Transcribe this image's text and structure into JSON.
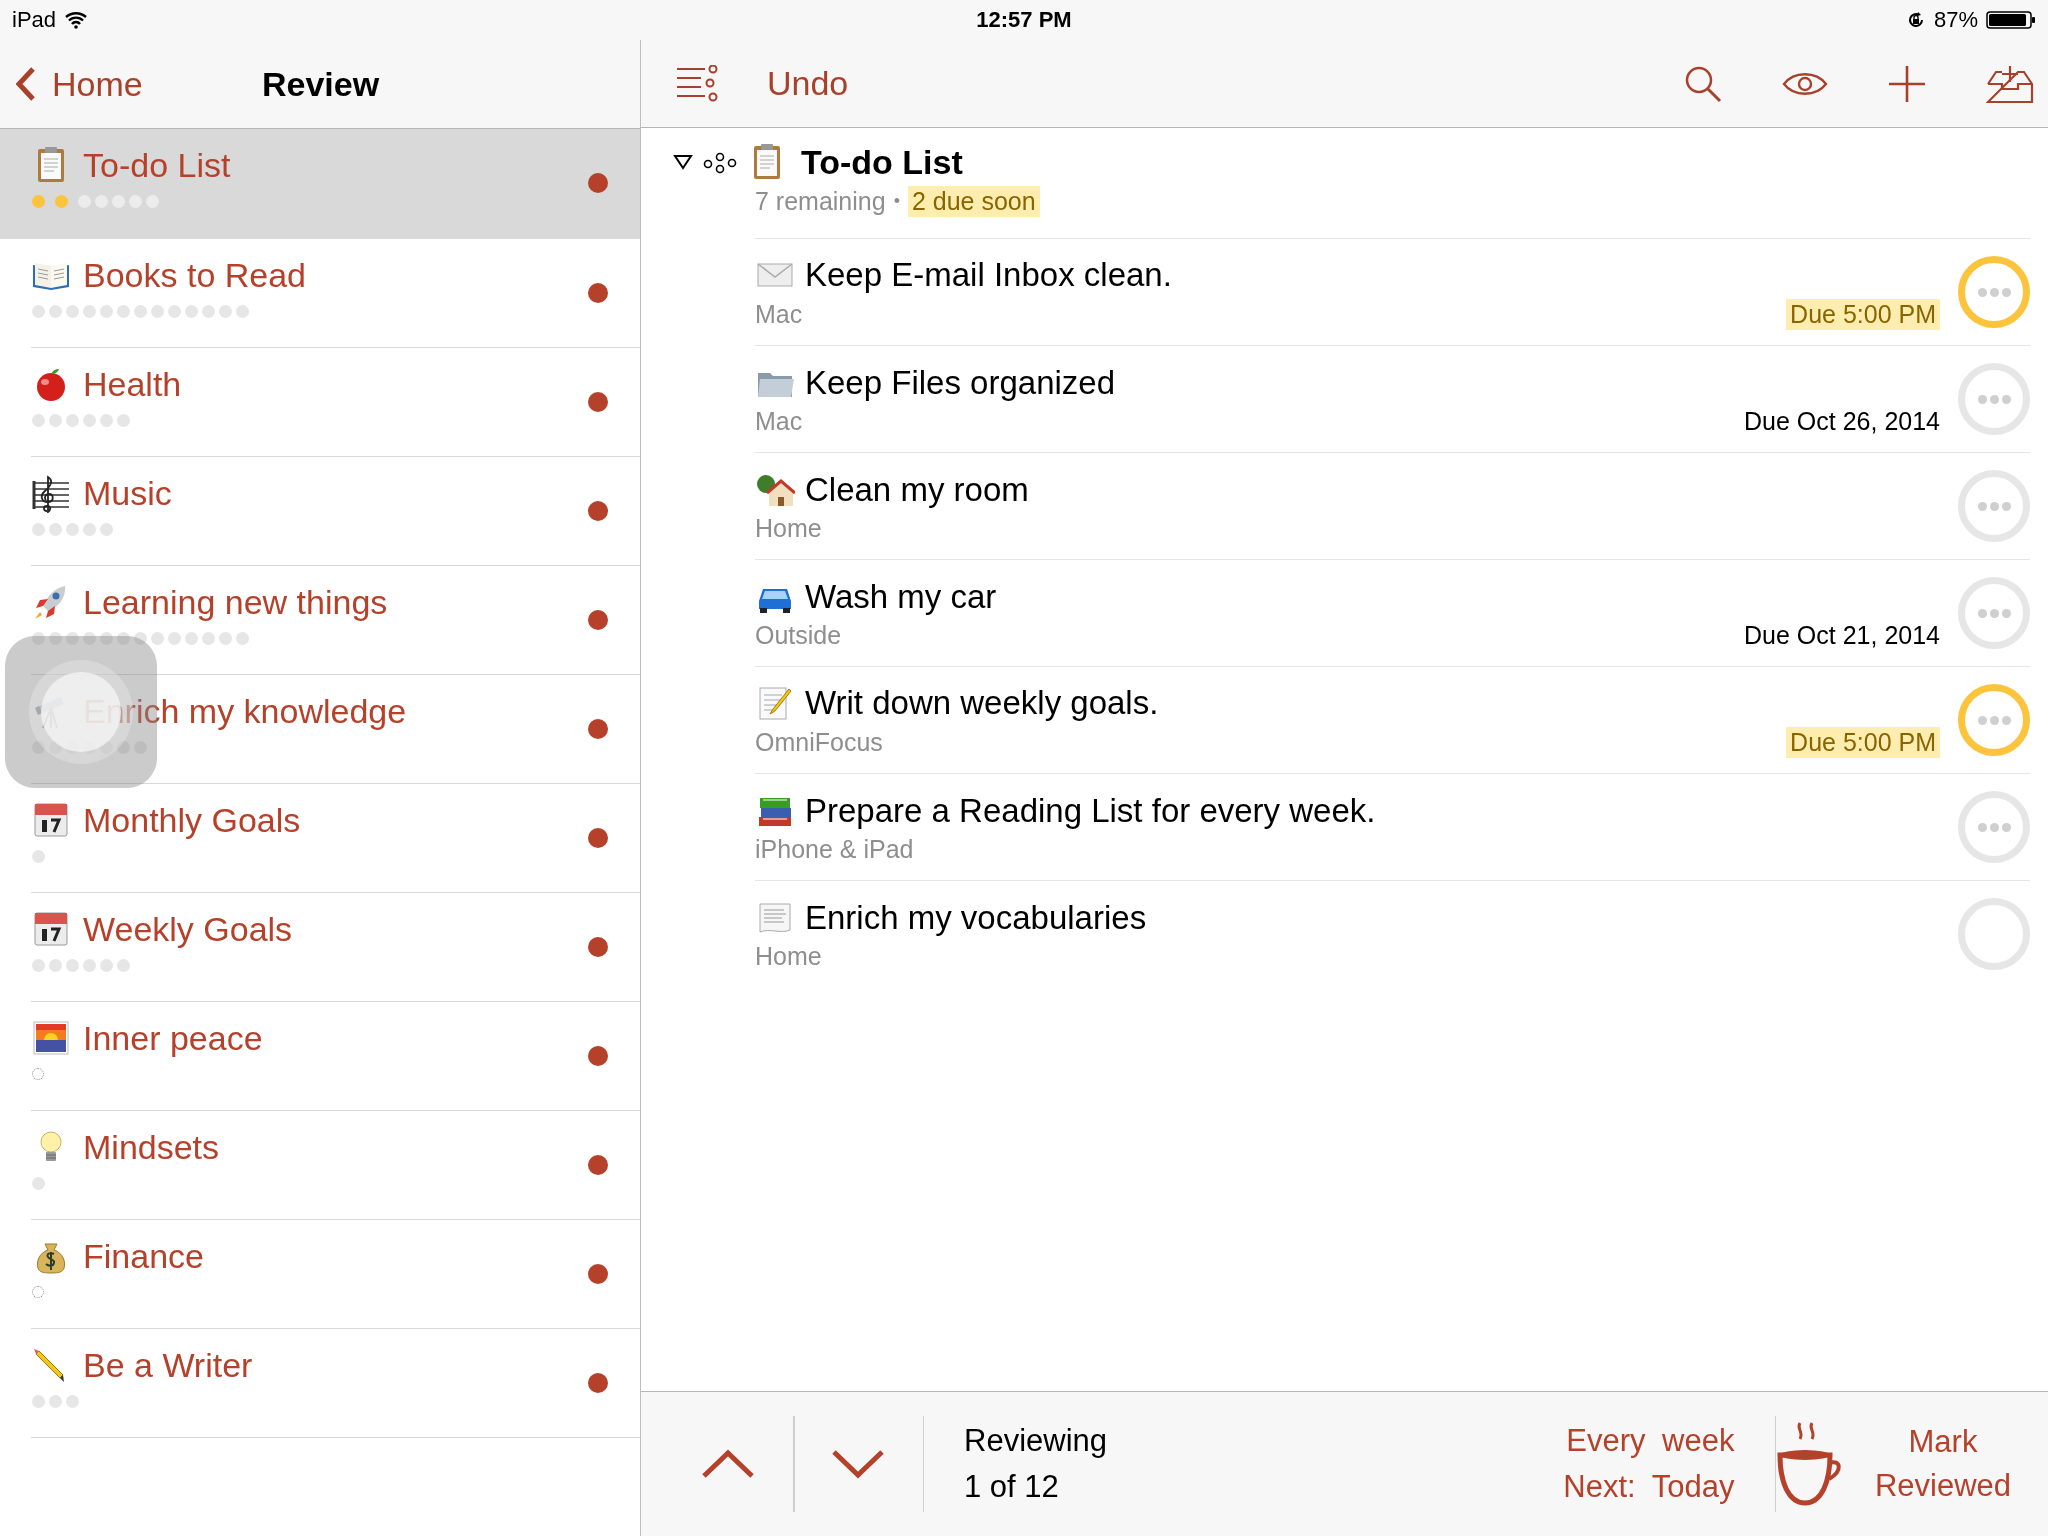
{
  "status_bar": {
    "device": "iPad",
    "time": "12:57 PM",
    "battery": "87%"
  },
  "sidebar": {
    "back": "Home",
    "title": "Review",
    "items": [
      {
        "label": "To-do List",
        "selected": true,
        "dots": [
          {
            "due_soon": true
          },
          {
            "due_soon": true
          },
          {
            "due_soon": false
          },
          {
            "due_soon": false
          },
          {
            "due_soon": false
          },
          {
            "due_soon": false
          },
          {
            "due_soon": false
          }
        ]
      },
      {
        "label": "Books to Read",
        "selected": false,
        "dots": [
          {
            "due_soon": false
          },
          {
            "due_soon": false
          },
          {
            "due_soon": false
          },
          {
            "due_soon": false
          },
          {
            "due_soon": false
          },
          {
            "due_soon": false
          },
          {
            "due_soon": false
          },
          {
            "due_soon": false
          },
          {
            "due_soon": false
          },
          {
            "due_soon": false
          },
          {
            "due_soon": false
          },
          {
            "due_soon": false
          },
          {
            "due_soon": false
          }
        ]
      },
      {
        "label": "Health",
        "selected": false,
        "dots": [
          {
            "due_soon": false
          },
          {
            "due_soon": false
          },
          {
            "due_soon": false
          },
          {
            "due_soon": false
          },
          {
            "due_soon": false
          },
          {
            "due_soon": false
          }
        ]
      },
      {
        "label": "Music",
        "selected": false,
        "dots": [
          {
            "due_soon": false
          },
          {
            "due_soon": false
          },
          {
            "due_soon": false
          },
          {
            "due_soon": false
          },
          {
            "due_soon": false
          }
        ]
      },
      {
        "label": "Learning new things",
        "selected": false,
        "dots": [
          {
            "due_soon": false
          },
          {
            "due_soon": false
          },
          {
            "due_soon": false
          },
          {
            "due_soon": false
          },
          {
            "due_soon": false
          },
          {
            "due_soon": false
          },
          {
            "due_soon": false
          },
          {
            "due_soon": false
          },
          {
            "due_soon": false
          },
          {
            "due_soon": false
          },
          {
            "due_soon": false
          },
          {
            "due_soon": false
          },
          {
            "due_soon": false
          }
        ]
      },
      {
        "label": "Enrich my knowledge",
        "selected": false,
        "dots": [
          {
            "due_soon": false
          },
          {
            "due_soon": false
          },
          {
            "due_soon": false
          },
          {
            "due_soon": false
          },
          {
            "due_soon": false
          },
          {
            "due_soon": false
          },
          {
            "due_soon": false
          }
        ]
      },
      {
        "label": "Monthly Goals",
        "selected": false,
        "dots": [
          {
            "due_soon": false
          }
        ]
      },
      {
        "label": "Weekly Goals",
        "selected": false,
        "dots": [
          {
            "due_soon": false
          },
          {
            "due_soon": false
          },
          {
            "due_soon": false
          },
          {
            "due_soon": false
          },
          {
            "due_soon": false
          },
          {
            "due_soon": false
          }
        ]
      },
      {
        "label": "Inner peace",
        "selected": false
      },
      {
        "label": "Mindsets",
        "selected": false,
        "dots": [
          {
            "due_soon": false
          }
        ]
      },
      {
        "label": "Finance",
        "selected": false
      },
      {
        "label": "Be a Writer",
        "selected": false,
        "dots": [
          {
            "due_soon": false
          },
          {
            "due_soon": false
          },
          {
            "due_soon": false
          }
        ]
      }
    ]
  },
  "toolbar": {
    "undo": "Undo"
  },
  "project": {
    "title": "To-do List",
    "expanded": true,
    "remaining": "7 remaining",
    "separator": "•",
    "due_soon": "2 due soon",
    "tasks": [
      {
        "title": "Keep E-mail Inbox clean.",
        "context": "Mac",
        "due": "Due 5:00 PM",
        "due_soon": true,
        "has_details": true
      },
      {
        "title": "Keep Files organized",
        "context": "Mac",
        "due": "Due Oct 26, 2014",
        "due_soon": false,
        "has_details": true
      },
      {
        "title": "Clean my room",
        "context": "Home",
        "due_soon": false,
        "has_details": true
      },
      {
        "title": "Wash my car",
        "context": "Outside",
        "due": "Due Oct 21, 2014",
        "due_soon": false,
        "has_details": true
      },
      {
        "title": "Writ down weekly goals.",
        "context": "OmniFocus",
        "due": "Due 5:00 PM",
        "due_soon": true,
        "has_details": true
      },
      {
        "title": "Prepare a Reading List for every week.",
        "context": "iPhone & iPad",
        "due_soon": false,
        "has_details": true
      },
      {
        "title": "Enrich my vocabularies",
        "context": "Home",
        "due_soon": false,
        "has_details": false
      }
    ]
  },
  "review_bar": {
    "status": "Reviewing",
    "position": "1 of 12",
    "interval": "Every week",
    "next": "Next: Today",
    "mark_button": "Mark Reviewed"
  }
}
